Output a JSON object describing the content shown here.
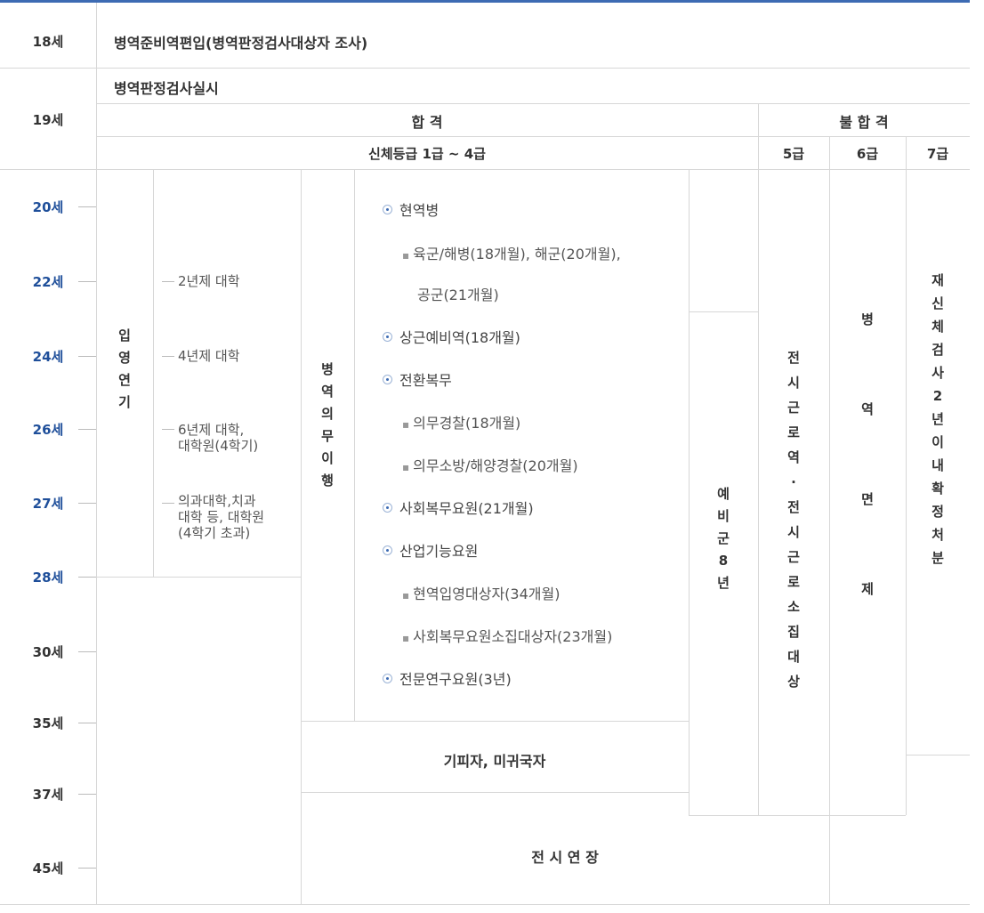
{
  "row18": {
    "age": "18세",
    "text": "병역준비역편입(병역판정검사대상자 조사)"
  },
  "row19": {
    "age": "19세",
    "exam": "병역판정검사실시",
    "pass": "합 격",
    "fail": "불 합 격",
    "grade_pass": "신체등급 1급 ~ 4급",
    "grade5": "5급",
    "grade6": "6급",
    "grade7": "7급"
  },
  "ages": [
    "20세",
    "22세",
    "24세",
    "26세",
    "27세",
    "28세",
    "30세",
    "35세",
    "37세",
    "45세"
  ],
  "enlist_delay": [
    "입",
    "영",
    "연",
    "기"
  ],
  "education": [
    "2년제 대학",
    "4년제 대학",
    "6년제 대학,\n대학원(4학기)",
    "의과대학,치과\n대학 등, 대학원\n(4학기 초과)"
  ],
  "military_service": [
    "병",
    "역",
    "의",
    "무",
    "이",
    "행"
  ],
  "service_items": {
    "active": "현역병",
    "active_sub1": "육군/해병(18개월), 해군(20개월),",
    "active_sub2": "공군(21개월)",
    "reserve_commute": "상근예비역(18개월)",
    "conversion": "전환복무",
    "conversion_sub1": "의무경찰(18개월)",
    "conversion_sub2": "의무소방/해양경찰(20개월)",
    "social": "사회복무요원(21개월)",
    "industrial": "산업기능요원",
    "industrial_sub1": "현역입영대상자(34개월)",
    "industrial_sub2": "사회복무요원소집대상자(23개월)",
    "research": "전문연구요원(3년)"
  },
  "reserve": [
    "예",
    "비",
    "군",
    "8",
    "년"
  ],
  "grade5_vertical": [
    "전",
    "시",
    "근",
    "로",
    "역",
    "·",
    "전",
    "시",
    "근",
    "로",
    "소",
    "집",
    "대",
    "상"
  ],
  "grade6_vertical": [
    "병",
    "역",
    "면",
    "제"
  ],
  "grade7_vertical": [
    "재",
    "신",
    "체",
    "검",
    "사",
    "2",
    "년",
    "이",
    "내",
    "확",
    "정",
    "처",
    "분"
  ],
  "evaders": "기피자, 미귀국자",
  "wartime": "전 시 연 장"
}
